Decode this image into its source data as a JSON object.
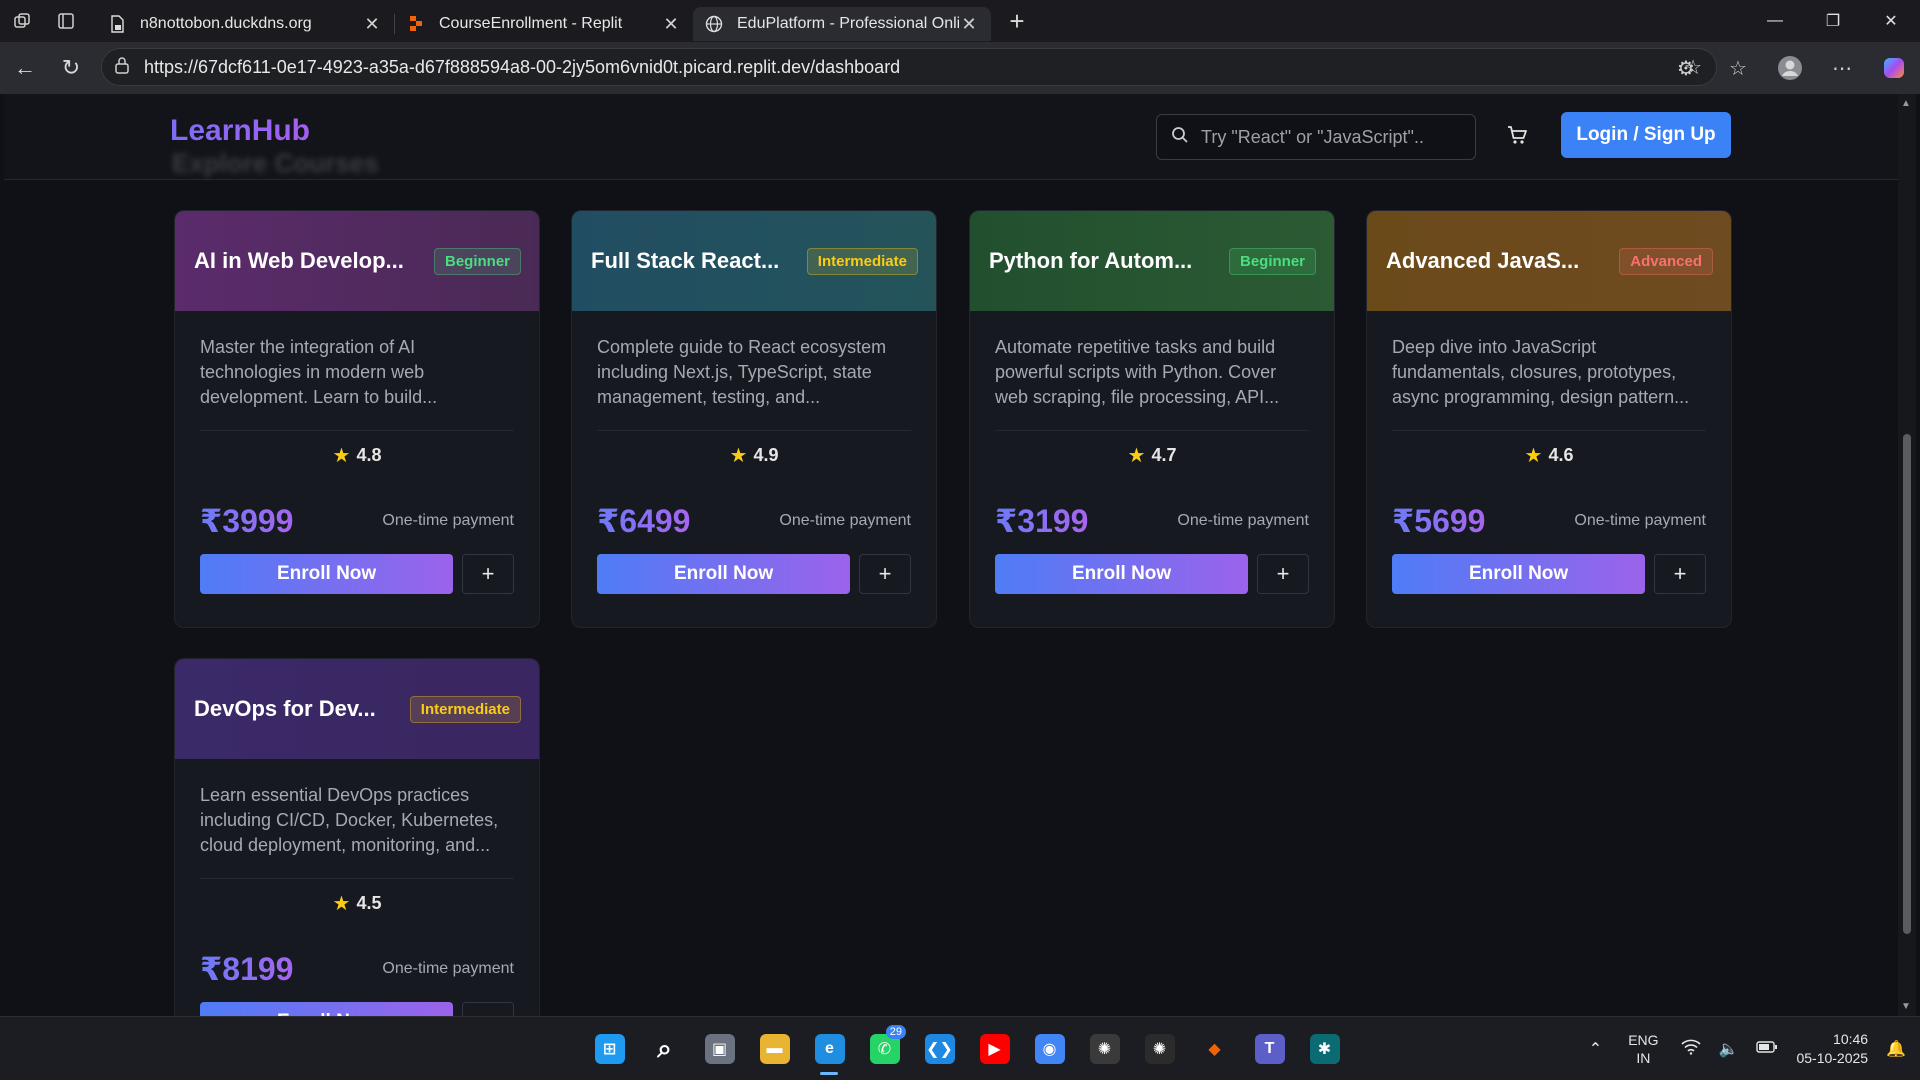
{
  "browser": {
    "tabs": [
      {
        "title": "n8nottobon.duckdns.org",
        "active": false,
        "icon": "page-lock-icon"
      },
      {
        "title": "CourseEnrollment - Replit",
        "active": false,
        "icon": "replit-icon"
      },
      {
        "title": "EduPlatform - Professional Online",
        "active": true,
        "icon": "globe-icon"
      }
    ],
    "url": "https://67dcf611-0e17-4923-a35a-d67f888594a8-00-2jy5om6vnid0t.picard.replit.dev/dashboard"
  },
  "site": {
    "logo": "LearnHub",
    "ghost_heading": "Explore Courses",
    "search_placeholder": "Try \"React\" or \"JavaScript\"..",
    "login_label": "Login / Sign Up"
  },
  "courses": [
    {
      "title": "AI in Web Develop...",
      "level": "Beginner",
      "level_class": "beginner",
      "description": "Master the integration of AI technologies in modern web development. Learn to build...",
      "rating": "4.8",
      "price": "₹3999",
      "payment_note": "One-time payment",
      "enroll_label": "Enroll Now",
      "head_gradient": [
        "#5b2b6b",
        "#4a2a55"
      ]
    },
    {
      "title": "Full Stack React...",
      "level": "Intermediate",
      "level_class": "intermediate",
      "description": "Complete guide to React ecosystem including Next.js, TypeScript, state management, testing, and...",
      "rating": "4.9",
      "price": "₹6499",
      "payment_note": "One-time payment",
      "enroll_label": "Enroll Now",
      "head_gradient": [
        "#214d62",
        "#24545a"
      ]
    },
    {
      "title": "Python for Autom...",
      "level": "Beginner",
      "level_class": "beginner",
      "description": "Automate repetitive tasks and build powerful scripts with Python. Cover web scraping, file processing, API...",
      "rating": "4.7",
      "price": "₹3199",
      "payment_note": "One-time payment",
      "enroll_label": "Enroll Now",
      "head_gradient": [
        "#22502f",
        "#2b5a33"
      ]
    },
    {
      "title": "Advanced JavaS...",
      "level": "Advanced",
      "level_class": "advanced",
      "description": "Deep dive into JavaScript fundamentals, closures, prototypes, async programming, design pattern...",
      "rating": "4.6",
      "price": "₹5699",
      "payment_note": "One-time payment",
      "enroll_label": "Enroll Now",
      "head_gradient": [
        "#6b4a1a",
        "#6e4b20"
      ]
    },
    {
      "title": "DevOps for Dev...",
      "level": "Intermediate",
      "level_class": "intermediate",
      "description": "Learn essential DevOps practices including CI/CD, Docker, Kubernetes, cloud deployment, monitoring, and...",
      "rating": "4.5",
      "price": "₹8199",
      "payment_note": "One-time payment",
      "enroll_label": "Enroll Now",
      "head_gradient": [
        "#3a2a68",
        "#3a2660"
      ]
    }
  ],
  "taskbar": {
    "apps": [
      "windows-start-icon",
      "search-icon",
      "task-view-icon",
      "file-explorer-icon",
      "edge-icon",
      "whatsapp-icon",
      "vscode-icon",
      "youtube-icon",
      "chrome-icon",
      "chatgpt-icon",
      "chatgpt-alt-icon",
      "replit-icon",
      "teams-icon",
      "perplexity-icon"
    ],
    "whatsapp_badge": "29",
    "lang_top": "ENG",
    "lang_bottom": "IN",
    "time": "10:46",
    "date": "05-10-2025"
  }
}
